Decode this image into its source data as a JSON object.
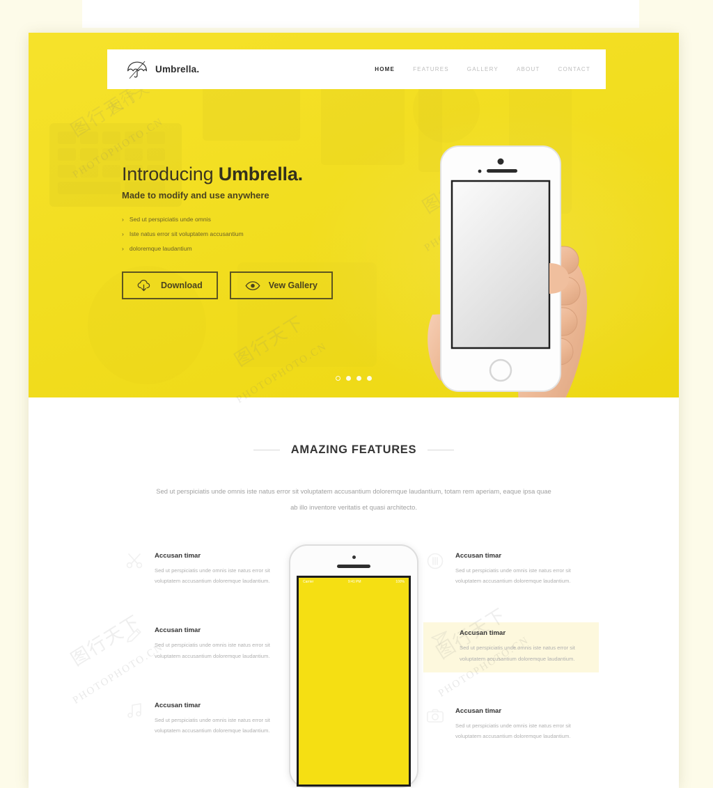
{
  "meta": {
    "page_kind": "landing-page-mockup",
    "accent_yellow": "#F5DF13",
    "page_bg": "#FDFBE9",
    "section_bg": "#FFFFFF"
  },
  "navbar": {
    "brand": {
      "name": "Umbrella.",
      "icon": "umbrella-icon"
    },
    "links": [
      {
        "label": "HOME",
        "active": true
      },
      {
        "label": "FEATURES",
        "active": false
      },
      {
        "label": "GALLERY",
        "active": false
      },
      {
        "label": "ABOUT",
        "active": false
      },
      {
        "label": "CONTACT",
        "active": false
      }
    ]
  },
  "hero": {
    "title_prefix": "Introducing ",
    "title_strong": "Umbrella.",
    "subtitle": "Made to modify and use anywhere",
    "bullets": [
      "Sed ut perspiciatis unde omnis",
      "Iste natus error sit voluptatem accusantium",
      "doloremque laudantium"
    ],
    "bullet_marker": "›",
    "buttons": [
      {
        "label": "Download",
        "icon": "cloud-download-icon"
      },
      {
        "label": "Vew Gallery",
        "icon": "eye-icon"
      }
    ],
    "slider_dots": [
      {
        "state": "active-hollow"
      },
      {
        "state": "filled"
      },
      {
        "state": "filled"
      },
      {
        "state": "filled"
      }
    ],
    "image": "hand-holding-white-iphone"
  },
  "features_section": {
    "title": "AMAZING FEATURES",
    "description": "Sed ut perspiciatis unde omnis iste natus error sit voluptatem accusantium doloremque laudantium, totam rem aperiam, eaque ipsa quae ab illo inventore veritatis et quasi architecto.",
    "phone_mock": {
      "screen_color": "#F5DF13",
      "status_left": "Carrier",
      "status_center": "9:41 PM",
      "status_right": "100%"
    },
    "left_items": [
      {
        "icon": "scissors-icon",
        "title": "Accusan timar",
        "body": "Sed ut perspiciatis unde omnis iste natus error sit voluptatem accusantium doloremque laudantium.",
        "highlight": false
      },
      {
        "icon": "pencil-icon",
        "title": "Accusan timar",
        "body": "Sed ut perspiciatis unde omnis iste natus error sit voluptatem accusantium doloremque laudantium.",
        "highlight": false
      },
      {
        "icon": "music-note-icon",
        "title": "Accusan timar",
        "body": "Sed ut perspiciatis unde omnis iste natus error sit voluptatem accusantium doloremque laudantium.",
        "highlight": false
      }
    ],
    "right_items": [
      {
        "icon": "headphones-icon",
        "title": "Accusan timar",
        "body": "Sed ut perspiciatis unde omnis iste natus error sit voluptatem accusantium doloremque laudantium.",
        "highlight": false
      },
      {
        "icon": "paper-plane-icon",
        "title": "Accusan timar",
        "body": "Sed ut perspiciatis unde omnis iste natus error sit voluptatem accusantium doloremque laudantium.",
        "highlight": true
      },
      {
        "icon": "camera-icon",
        "title": "Accusan timar",
        "body": "Sed ut perspiciatis unde omnis iste natus error sit voluptatem accusantium doloremque laudantium.",
        "highlight": false
      }
    ]
  },
  "watermarks": {
    "text_cn": "图行天下",
    "text_en": "PHOTOPHOTO.CN"
  }
}
